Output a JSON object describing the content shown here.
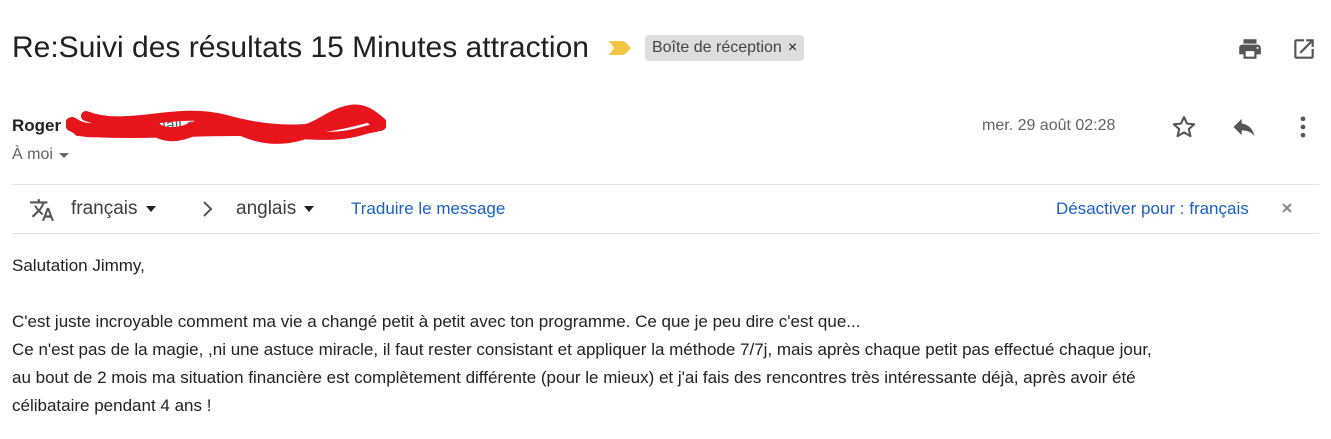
{
  "subject": "Re:Suivi des résultats 15 Minutes attraction",
  "label": {
    "text": "Boîte de réception",
    "close": "×"
  },
  "sender": {
    "name": "Roger S",
    "email": "roger@gmail.com",
    "recipient": "À moi"
  },
  "date": "mer. 29 août 02:28",
  "translate": {
    "from_lang": "français",
    "to_lang": "anglais",
    "translate_link": "Traduire le message",
    "disable_link": "Désactiver pour : français"
  },
  "body": {
    "greeting": "Salutation Jimmy,",
    "line1": "C'est juste incroyable comment ma vie a changé petit à petit avec ton programme. Ce que je peu dire c'est que...",
    "line2": "Ce n'est pas de la magie, ,ni une astuce miracle, il faut rester consistant et appliquer la méthode 7/7j, mais après chaque petit pas effectué chaque jour,",
    "line3": "au bout de 2 mois ma situation financière est complètement différente (pour le mieux) et j'ai fais des rencontres très intéressante déjà, après avoir été",
    "line4": "célibataire pendant 4 ans !"
  },
  "icons": {
    "importance": "importance-marker-icon",
    "print": "print-icon",
    "open_new": "open-in-new-window-icon",
    "star": "star-icon",
    "reply": "reply-icon",
    "more": "more-vert-icon",
    "translate": "translate-icon"
  },
  "colors": {
    "importance": "#f4c542",
    "link": "#1a5fc9",
    "redaction": "#e8141c"
  }
}
